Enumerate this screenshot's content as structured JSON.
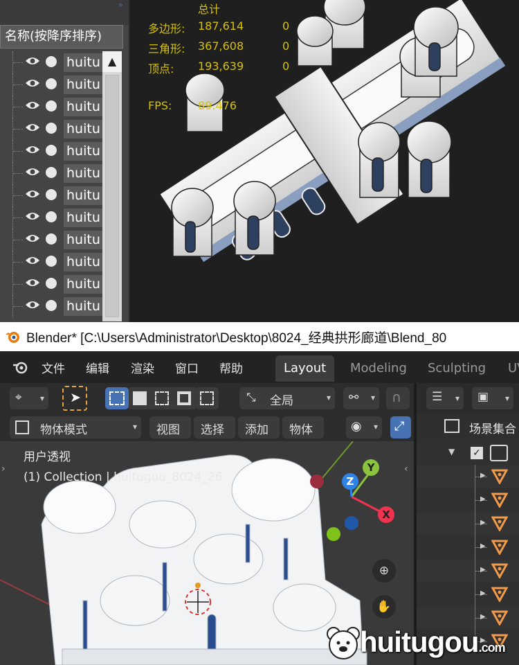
{
  "max_panel": {
    "header": "名称(按降序排序)",
    "items": [
      "huitu",
      "huitu",
      "huitu",
      "huitu",
      "huitu",
      "huitu",
      "huitu",
      "huitu",
      "huitu",
      "huitu",
      "huitu",
      "huitu"
    ],
    "scroll_up_icon": "chevron-up-icon"
  },
  "stats": {
    "title": "总计",
    "rows": [
      {
        "label": "多边形:",
        "value": "187,614",
        "extra": "0"
      },
      {
        "label": "三角形:",
        "value": "367,608",
        "extra": "0"
      },
      {
        "label": "顶点:",
        "value": "193,639",
        "extra": "0"
      }
    ],
    "fps_label": "FPS:",
    "fps_value": "89.476"
  },
  "blender": {
    "title": "Blender* [C:\\Users\\Administrator\\Desktop\\8024_经典拱形廊道\\Blend_80",
    "menu": [
      "文件",
      "编辑",
      "渲染",
      "窗口",
      "帮助"
    ],
    "workspaces": [
      "Layout",
      "Modeling",
      "Sculpting",
      "UV"
    ],
    "active_workspace": "Layout",
    "transform_orientation": "全局",
    "mode": "物体模式",
    "header_menus": [
      "视图",
      "选择",
      "添加",
      "物体"
    ],
    "viewport_label": "用户透视",
    "viewport_collection": "(1) Collection | huitugou_8024_26",
    "axes": {
      "x": "X",
      "y": "Y",
      "z": "Z"
    },
    "outliner_title": "场景集合",
    "outliner_rows": 8,
    "accent_color": "#4772b3",
    "x_color": "#f0344f",
    "y_color": "#8bc53f",
    "z_color": "#2f83e6"
  },
  "watermark": {
    "text": "huitugou",
    "suffix": ".com"
  }
}
